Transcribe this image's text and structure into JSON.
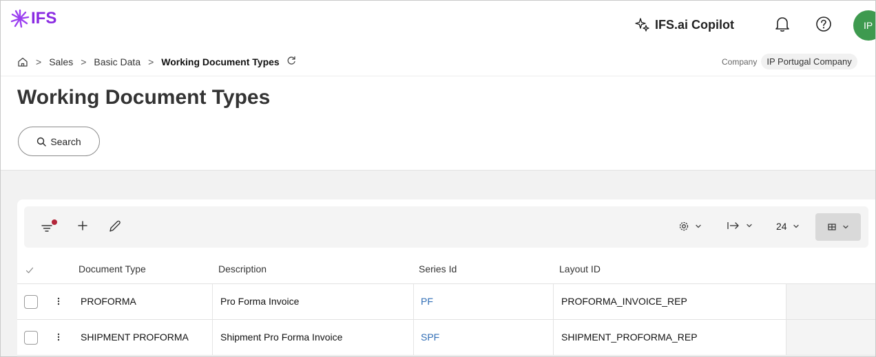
{
  "header": {
    "logo_text": "IFS",
    "copilot_label": "IFS.ai Copilot",
    "avatar_initials": "IP",
    "brand_color": "#8a2be2",
    "avatar_color": "#3e9a4f"
  },
  "breadcrumb": {
    "items": [
      "Sales",
      "Basic Data"
    ],
    "current": "Working Document Types"
  },
  "company": {
    "label": "Company",
    "value": "IP Portugal Company"
  },
  "page": {
    "title": "Working Document Types",
    "search_label": "Search"
  },
  "toolbar": {
    "rows_per_page": "24",
    "icons": [
      "filter-icon",
      "add-icon",
      "edit-icon",
      "settings-icon",
      "tab-arrow-icon",
      "table-view-icon"
    ]
  },
  "table": {
    "columns": [
      "Document Type",
      "Description",
      "Series Id",
      "Layout ID"
    ],
    "rows": [
      {
        "document_type": "PROFORMA",
        "description": "Pro Forma Invoice",
        "series_id": "PF",
        "layout_id": "PROFORMA_INVOICE_REP"
      },
      {
        "document_type": "SHIPMENT PROFORMA",
        "description": "Shipment Pro Forma Invoice",
        "series_id": "SPF",
        "layout_id": "SHIPMENT_PROFORMA_REP"
      }
    ]
  }
}
